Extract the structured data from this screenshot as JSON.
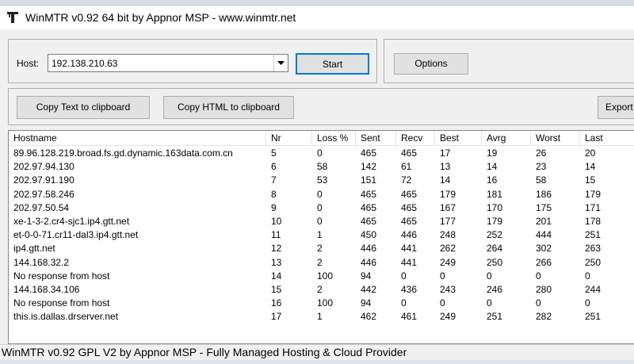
{
  "window": {
    "title": "WinMTR v0.92 64 bit by Appnor MSP - www.winmtr.net"
  },
  "host": {
    "label": "Host:",
    "value": "192.138.210.63"
  },
  "buttons": {
    "start": "Start",
    "options": "Options",
    "copy_text": "Copy Text to clipboard",
    "copy_html": "Copy HTML to clipboard",
    "export": "Export"
  },
  "table": {
    "columns": [
      "Hostname",
      "Nr",
      "Loss %",
      "Sent",
      "Recv",
      "Best",
      "Avrg",
      "Worst",
      "Last"
    ],
    "rows": [
      [
        "89.96.128.219.broad.fs.gd.dynamic.163data.com.cn",
        "5",
        "0",
        "465",
        "465",
        "17",
        "19",
        "26",
        "20"
      ],
      [
        "202.97.94.130",
        "6",
        "58",
        "142",
        "61",
        "13",
        "14",
        "23",
        "14"
      ],
      [
        "202.97.91.190",
        "7",
        "53",
        "151",
        "72",
        "14",
        "16",
        "58",
        "15"
      ],
      [
        "202.97.58.246",
        "8",
        "0",
        "465",
        "465",
        "179",
        "181",
        "186",
        "179"
      ],
      [
        "202.97.50.54",
        "9",
        "0",
        "465",
        "465",
        "167",
        "170",
        "175",
        "171"
      ],
      [
        "xe-1-3-2.cr4-sjc1.ip4.gtt.net",
        "10",
        "0",
        "465",
        "465",
        "177",
        "179",
        "201",
        "178"
      ],
      [
        "et-0-0-71.cr11-dal3.ip4.gtt.net",
        "11",
        "1",
        "450",
        "446",
        "248",
        "252",
        "444",
        "251"
      ],
      [
        "ip4.gtt.net",
        "12",
        "2",
        "446",
        "441",
        "262",
        "264",
        "302",
        "263"
      ],
      [
        "144.168.32.2",
        "13",
        "2",
        "446",
        "441",
        "249",
        "250",
        "266",
        "250"
      ],
      [
        "No response from host",
        "14",
        "100",
        "94",
        "0",
        "0",
        "0",
        "0",
        "0"
      ],
      [
        "144.168.34.106",
        "15",
        "2",
        "442",
        "436",
        "243",
        "246",
        "280",
        "244"
      ],
      [
        "No response from host",
        "16",
        "100",
        "94",
        "0",
        "0",
        "0",
        "0",
        "0"
      ],
      [
        "this.is.dallas.drserver.net",
        "17",
        "1",
        "462",
        "461",
        "249",
        "251",
        "282",
        "251"
      ]
    ]
  },
  "status": {
    "text": "WinMTR v0.92 GPL V2 by Appnor MSP - Fully Managed Hosting & Cloud Provider"
  },
  "icons": {
    "app": "winmtr-app-icon",
    "combo_arrow": "chevron-down-icon"
  },
  "colors": {
    "focus_border": "#0078d7",
    "button_face": "#e1e1e1",
    "window_bg": "#f0f0f0"
  }
}
